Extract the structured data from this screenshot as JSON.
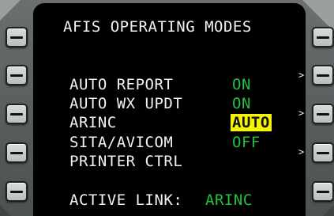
{
  "screen": {
    "title": "AFIS OPERATING MODES",
    "items": [
      {
        "label": "AUTO REPORT",
        "value": "ON"
      },
      {
        "label": "AUTO WX UPDT",
        "value": "ON"
      },
      {
        "label": "ARINC",
        "value": "AUTO",
        "selected": true
      },
      {
        "label": "SITA/AVICOM",
        "value": "OFF"
      },
      {
        "label": "PRINTER CTRL",
        "value": ""
      }
    ],
    "active_link_label": "ACTIVE LINK:",
    "active_link_value": "ARINC",
    "caret_glyph": ">"
  },
  "colors": {
    "label": "#f2f2f2",
    "value": "#22c040",
    "selected_background": "#f5f500",
    "selected_text": "#111111",
    "screen_background": "#000000"
  },
  "icons": {
    "line_select_key": "dash-button-icon",
    "more_indicator": "chevron-right-icon"
  }
}
